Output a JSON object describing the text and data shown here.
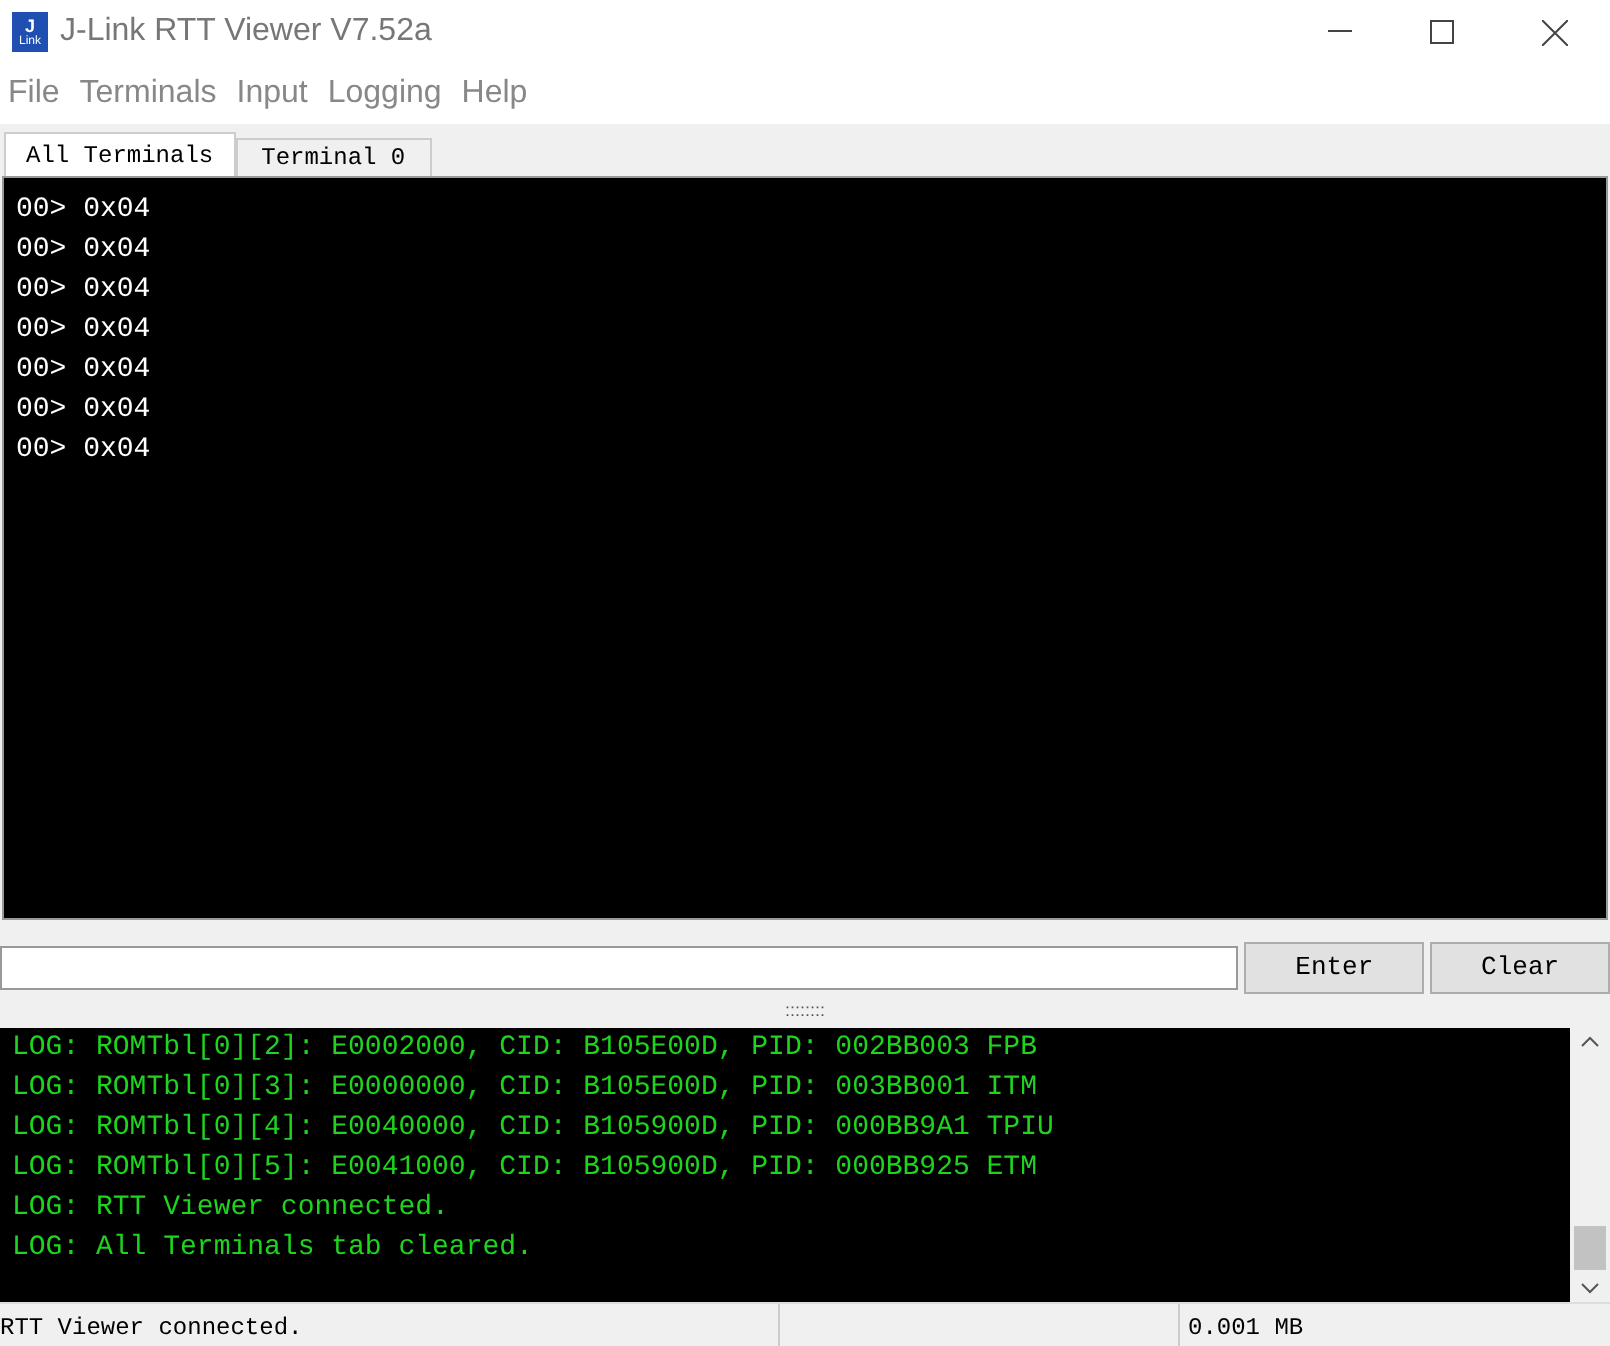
{
  "window": {
    "title": "J-Link RTT Viewer V7.52a",
    "app_icon_text": [
      "J",
      "Link"
    ]
  },
  "menu": [
    "File",
    "Terminals",
    "Input",
    "Logging",
    "Help"
  ],
  "tabs": [
    {
      "label": "All Terminals",
      "selected": true
    },
    {
      "label": "Terminal 0",
      "selected": false
    }
  ],
  "terminal_lines": [
    "00> 0x04",
    "00> 0x04",
    "00> 0x04",
    "00> 0x04",
    "00> 0x04",
    "00> 0x04",
    "00> 0x04"
  ],
  "buttons": [
    "Enter",
    "Clear"
  ],
  "splitter": "::::::::",
  "log_lines": [
    "LOG: ROMTbl[0][2]: E0002000, CID: B105E00D, PID: 002BB003 FPB",
    "LOG: ROMTbl[0][3]: E0000000, CID: B105E00D, PID: 003BB001 ITM",
    "LOG: ROMTbl[0][4]: E0040000, CID: B105900D, PID: 000BB9A1 TPIU",
    "LOG: ROMTbl[0][5]: E0041000, CID: B105900D, PID: 000BB925 ETM",
    "LOG: RTT Viewer connected.",
    "LOG: All Terminals tab cleared."
  ],
  "status_bar": [
    "RTT Viewer connected.",
    "0.001 MB"
  ]
}
